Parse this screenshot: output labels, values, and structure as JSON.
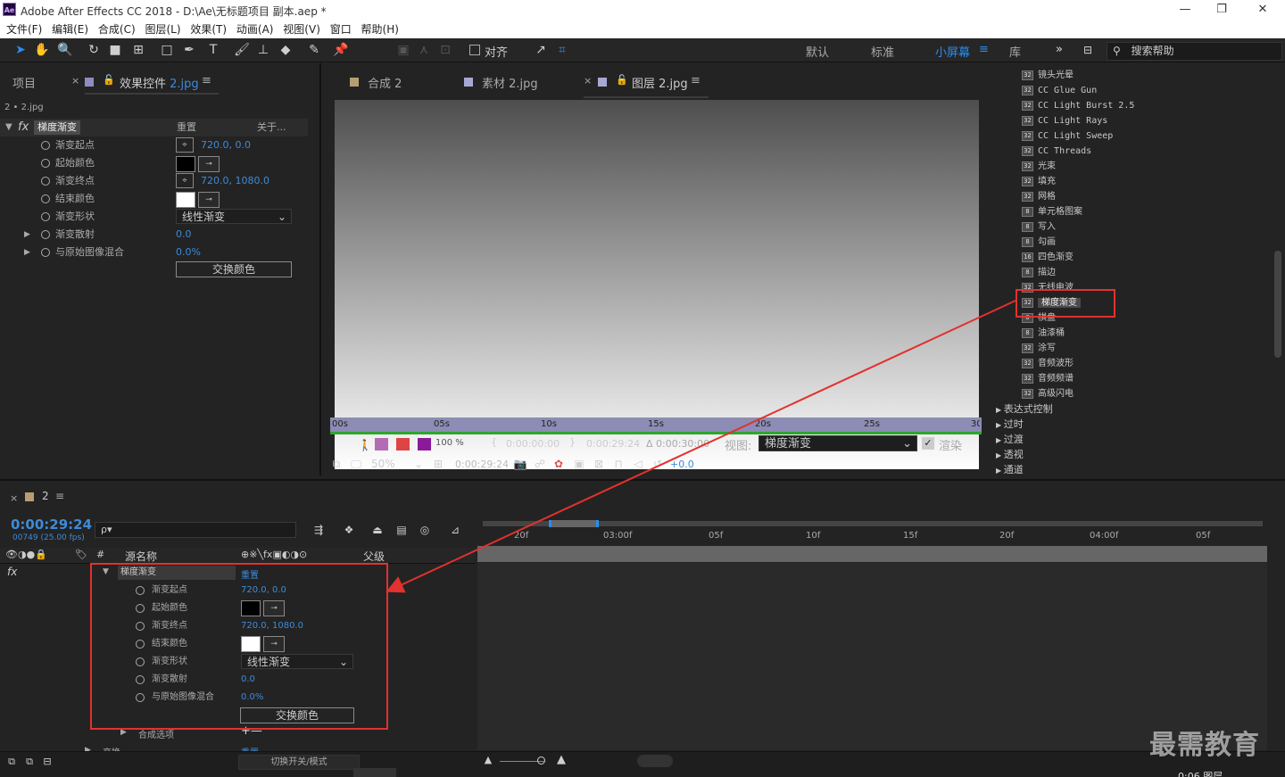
{
  "window": {
    "title": "Adobe After Effects CC 2018 - D:\\Ae\\无标题项目 副本.aep *",
    "logo": "Ae",
    "min": "—",
    "max": "❐",
    "close": "✕"
  },
  "menu": [
    "文件(F)",
    "编辑(E)",
    "合成(C)",
    "图层(L)",
    "效果(T)",
    "动画(A)",
    "视图(V)",
    "窗口",
    "帮助(H)"
  ],
  "toolbar": {
    "align_label": "对齐",
    "workspaces": [
      "默认",
      "标准",
      "小屏幕",
      "库"
    ],
    "more": "»",
    "search_placeholder": "搜索帮助"
  },
  "left_panel": {
    "tab_project": "项目",
    "tab_effect_prefix": "效果控件",
    "tab_effect_file": "2.jpg",
    "breadcrumb": "2 • 2.jpg",
    "fx_label": "fx",
    "effect_name": "梯度渐变",
    "reset": "重置",
    "about": "关于...",
    "props": [
      {
        "label": "渐变起点",
        "value": "720.0, 0.0"
      },
      {
        "label": "起始颜色",
        "value": ""
      },
      {
        "label": "渐变终点",
        "value": "720.0, 1080.0"
      },
      {
        "label": "结束颜色",
        "value": ""
      },
      {
        "label": "渐变形状",
        "value": "线性渐变"
      },
      {
        "label": "渐变散射",
        "value": "0.0"
      },
      {
        "label": "与原始图像混合",
        "value": "0.0%"
      }
    ],
    "swap_button": "交换颜色",
    "start_color": "#000000",
    "end_color": "#ffffff"
  },
  "viewer": {
    "tabs": [
      "合成 2",
      "素材 2.jpg",
      "图层 2.jpg"
    ],
    "ruler": [
      "00s",
      "05s",
      "10s",
      "15s",
      "20s",
      "25s",
      "30s"
    ],
    "opacity": "100 %",
    "time_in": "0:00:00:00",
    "time_out": "0:00:29:24",
    "duration": "Δ 0:00:30:00",
    "view_label": "视图:",
    "view_value": "梯度渐变",
    "render_label": "渲染",
    "zoom": "50%",
    "current_time": "0:00:29:24",
    "exposure": "+0.0"
  },
  "effects_panel": {
    "items": [
      "镜头光晕",
      "CC Glue Gun",
      "CC Light Burst 2.5",
      "CC Light Rays",
      "CC Light Sweep",
      "CC Threads",
      "光束",
      "填充",
      "网格",
      "单元格图案",
      "写入",
      "勾画",
      "四色渐变",
      "描边",
      "无线电波",
      "梯度渐变",
      "棋盘",
      "油漆桶",
      "涂写",
      "音频波形",
      "音频频谱",
      "高级闪电"
    ],
    "icon_labels": [
      "32",
      "32",
      "32",
      "32",
      "32",
      "32",
      "32",
      "32",
      "32",
      "8",
      "8",
      "8",
      "16",
      "8",
      "32",
      "32",
      "8",
      "8",
      "32",
      "32",
      "32",
      "32"
    ],
    "categories": [
      "表达式控制",
      "过时",
      "过渡",
      "透视",
      "通道"
    ]
  },
  "timeline": {
    "comp_name": "2",
    "timecode": "0:00:29:24",
    "frames": "00749 (25.00 fps)",
    "search_icon_text": "ρ▾",
    "col_source": "源名称",
    "col_parent": "父级",
    "fx_label": "fx",
    "effect_name": "梯度渐变",
    "reset": "重置",
    "props": [
      {
        "label": "渐变起点",
        "value": "720.0, 0.0"
      },
      {
        "label": "起始颜色",
        "value": ""
      },
      {
        "label": "渐变终点",
        "value": "720.0, 1080.0"
      },
      {
        "label": "结束颜色",
        "value": ""
      },
      {
        "label": "渐变形状",
        "value": "线性渐变"
      },
      {
        "label": "渐变散射",
        "value": "0.0"
      },
      {
        "label": "与原始图像混合",
        "value": "0.0%"
      }
    ],
    "swap_button": "交换颜色",
    "composite_label": "合成选项",
    "composite_ctrl": "+—",
    "transform_label": "变换",
    "transform_reset": "重置",
    "toggle_label": "切换开关/模式",
    "ruler": [
      "20f",
      "03:00f",
      "05f",
      "10f",
      "15f",
      "20f",
      "04:00f",
      "05f"
    ]
  },
  "watermark": "最需教育",
  "corner_text": "0:06 图层",
  "colors": {
    "accent": "#2d8ceb",
    "annotation": "#e2312e"
  }
}
